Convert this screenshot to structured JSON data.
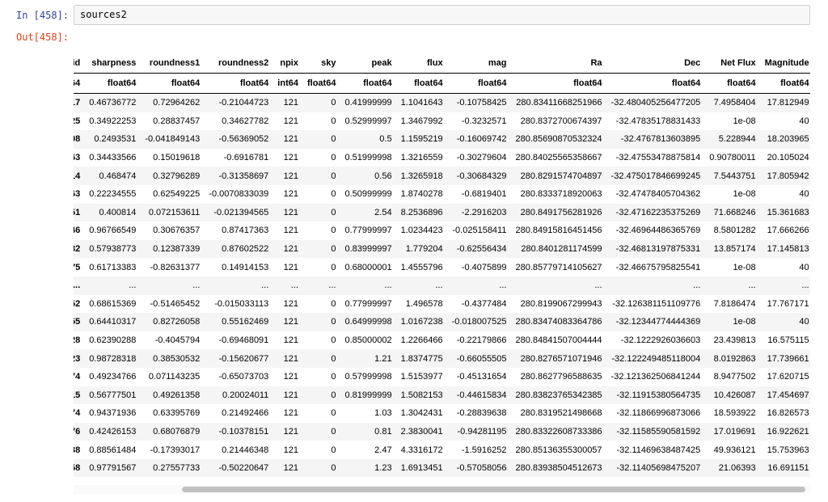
{
  "input_prompt": "In [458]:",
  "output_prompt": "Out[458]:",
  "code": "sources2",
  "columns": [
    "id",
    "sharpness",
    "roundness1",
    "roundness2",
    "npix",
    "sky",
    "peak",
    "flux",
    "mag",
    "Ra",
    "Dec",
    "Net Flux",
    "Magnitude"
  ],
  "dtypes": [
    "64",
    "float64",
    "float64",
    "float64",
    "int64",
    "float64",
    "float64",
    "float64",
    "float64",
    "float64",
    "float64",
    "float64",
    "float64"
  ],
  "rows": [
    [
      "17",
      "0.46736772",
      "0.72964262",
      "-0.21044723",
      "121",
      "0",
      "0.41999999",
      "1.1041643",
      "-0.10758425",
      "280.83411668251966",
      "-32.480405256477205",
      "7.4958404",
      "17.812949"
    ],
    [
      "25",
      "0.34922253",
      "0.28837457",
      "0.34627782",
      "121",
      "0",
      "0.52999997",
      "1.3467992",
      "-0.3232571",
      "280.8372700674397",
      "-32.47835178831433",
      "1e-08",
      "40"
    ],
    [
      "08",
      "0.2493531",
      "-0.041849143",
      "-0.56369052",
      "121",
      "0",
      "0.5",
      "1.1595219",
      "-0.16069742",
      "280.85690870532324",
      "-32.4767813603895",
      "5.228944",
      "18.203965"
    ],
    [
      "63",
      "0.34433566",
      "0.15019618",
      "-0.6916781",
      "121",
      "0",
      "0.51999998",
      "1.3216559",
      "-0.30279604",
      "280.84025565358667",
      "-32.47553478875814",
      "0.90780011",
      "20.105024"
    ],
    [
      "14",
      "0.468474",
      "0.32796289",
      "-0.31358697",
      "121",
      "0",
      "0.56",
      "1.3265918",
      "-0.30684329",
      "280.8291574704897",
      "-32.475017846699245",
      "7.5443751",
      "17.805942"
    ],
    [
      "63",
      "0.22234555",
      "0.62549225",
      "-0.0070833039",
      "121",
      "0",
      "0.50999999",
      "1.8740278",
      "-0.6819401",
      "280.8333718920063",
      "-32.47478405704362",
      "1e-08",
      "40"
    ],
    [
      "51",
      "0.400814",
      "0.072153611",
      "-0.021394565",
      "121",
      "0",
      "2.54",
      "8.2536896",
      "-2.2916203",
      "280.8491756281926",
      "-32.47162235375269",
      "71.668246",
      "15.361683"
    ],
    [
      "46",
      "0.96766549",
      "0.30676357",
      "0.87417363",
      "121",
      "0",
      "0.77999997",
      "1.0234423",
      "-0.025158411",
      "280.84915816451456",
      "-32.46964486365769",
      "8.5801282",
      "17.666266"
    ],
    [
      "82",
      "0.57938773",
      "0.12387339",
      "0.87602522",
      "121",
      "0",
      "0.83999997",
      "1.779204",
      "-0.62556434",
      "280.8401281174599",
      "-32.46813197875331",
      "13.857174",
      "17.145813"
    ],
    [
      "75",
      "0.61713383",
      "-0.82631377",
      "0.14914153",
      "121",
      "0",
      "0.68000001",
      "1.4555796",
      "-0.4075899",
      "280.85779714105627",
      "-32.46675795825541",
      "1e-08",
      "40"
    ],
    [
      "...",
      "...",
      "...",
      "...",
      "...",
      "...",
      "...",
      "...",
      "...",
      "...",
      "...",
      "...",
      "..."
    ],
    [
      "52",
      "0.68615369",
      "-0.51465452",
      "-0.015033113",
      "121",
      "0",
      "0.77999997",
      "1.496578",
      "-0.4377484",
      "280.8199067299943",
      "-32.126381151109776",
      "7.8186474",
      "17.767171"
    ],
    [
      "55",
      "0.64410317",
      "0.82726058",
      "0.55162469",
      "121",
      "0",
      "0.64999998",
      "1.0167238",
      "-0.018007525",
      "280.83474083364786",
      "-32.12344774444369",
      "1e-08",
      "40"
    ],
    [
      "28",
      "0.62390288",
      "-0.4045794",
      "-0.69468091",
      "121",
      "0",
      "0.85000002",
      "1.2266466",
      "-0.22179866",
      "280.84841507004444",
      "-32.1222926036603",
      "23.439813",
      "16.575115"
    ],
    [
      "23",
      "0.98728318",
      "0.38530532",
      "-0.15620677",
      "121",
      "0",
      "1.21",
      "1.8374775",
      "-0.66055505",
      "280.8276571071946",
      "-32.122249485118004",
      "8.0192863",
      "17.739661"
    ],
    [
      "74",
      "0.49234766",
      "0.071143235",
      "-0.65073703",
      "121",
      "0",
      "0.57999998",
      "1.5153977",
      "-0.45131654",
      "280.8627796588635",
      "-32.121362506841244",
      "8.9477502",
      "17.620715"
    ],
    [
      "15",
      "0.56777501",
      "0.49261358",
      "0.20024011",
      "121",
      "0",
      "0.81999999",
      "1.5082153",
      "-0.44615834",
      "280.83823765342385",
      "-32.11915380564735",
      "10.426087",
      "17.454697"
    ],
    [
      "74",
      "0.94371936",
      "0.63395769",
      "0.21492466",
      "121",
      "0",
      "1.03",
      "1.3042431",
      "-0.28839638",
      "280.8319521498668",
      "-32.11866996873066",
      "18.593922",
      "16.826573"
    ],
    [
      "76",
      "0.42426153",
      "0.68076879",
      "-0.10378151",
      "121",
      "0",
      "0.81",
      "2.3830041",
      "-0.94281195",
      "280.83322608733386",
      "-32.11585590581592",
      "17.019691",
      "16.922621"
    ],
    [
      "38",
      "0.88561484",
      "-0.17393017",
      "0.21446348",
      "121",
      "0",
      "2.47",
      "4.3316172",
      "-1.5916252",
      "280.85136355300057",
      "-32.11469638487425",
      "49.936121",
      "15.753963"
    ],
    [
      "58",
      "0.97791567",
      "0.27557733",
      "-0.50220647",
      "121",
      "0",
      "1.23",
      "1.6913451",
      "-0.57058056",
      "280.83938504512673",
      "-32.11405698475207",
      "21.06393",
      "16.691151"
    ]
  ]
}
